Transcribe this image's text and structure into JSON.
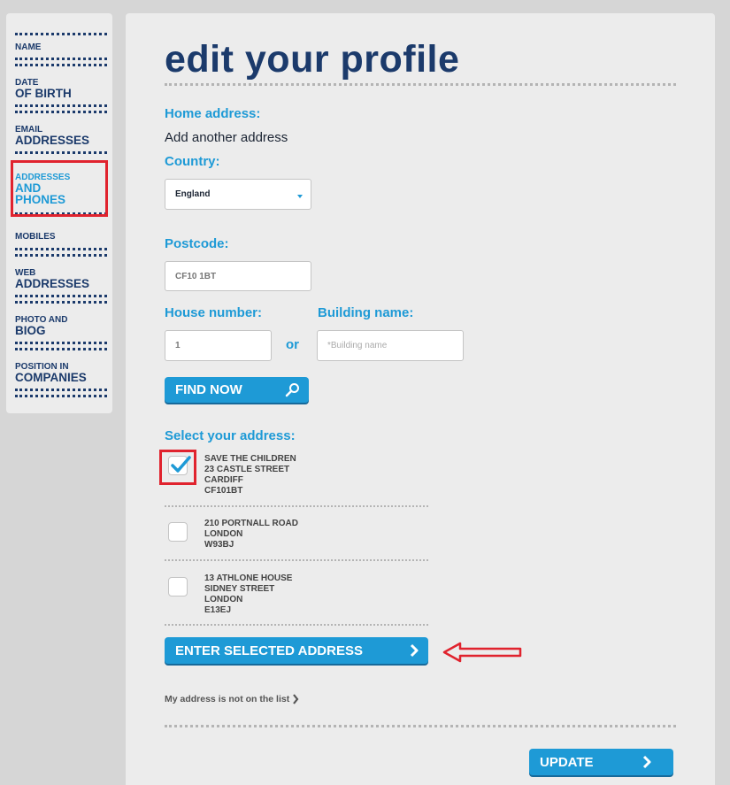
{
  "sidebar": {
    "items": [
      {
        "line1": "",
        "line2": "",
        "label": "NAME"
      },
      {
        "line1": "DATE",
        "line2": "OF BIRTH"
      },
      {
        "line1": "EMAIL",
        "line2": "ADDRESSES"
      },
      {
        "line1": "ADDRESSES",
        "line2": "AND",
        "line3": "PHONES"
      },
      {
        "line1": "MOBILES"
      },
      {
        "line1": "WEB",
        "line2": "ADDRESSES"
      },
      {
        "line1": "PHOTO AND",
        "line2": "BIOG"
      },
      {
        "line1": "POSITION IN",
        "line2": "COMPANIES"
      }
    ]
  },
  "main": {
    "title": "edit your profile",
    "home_address_label": "Home address:",
    "add_another": "Add another address",
    "country_label": "Country:",
    "country_value": "England",
    "postcode_label": "Postcode:",
    "postcode_value": "CF10 1BT",
    "house_number_label": "House number:",
    "house_number_value": "1",
    "or_text": "or",
    "building_name_label": "Building name:",
    "building_name_placeholder": "*Building name",
    "find_now_label": "FIND NOW",
    "select_address_label": "Select your address:",
    "addresses": [
      {
        "lines": [
          "SAVE THE CHILDREN",
          "23 CASTLE STREET",
          "CARDIFF",
          "CF101BT"
        ],
        "checked": true
      },
      {
        "lines": [
          "210 PORTNALL ROAD",
          "LONDON",
          "W93BJ"
        ],
        "checked": false
      },
      {
        "lines": [
          "13 ATHLONE HOUSE",
          "SIDNEY STREET",
          "LONDON",
          "E13EJ"
        ],
        "checked": false
      }
    ],
    "enter_selected_label": "ENTER SELECTED ADDRESS",
    "not_on_list_label": "My address is not on the list",
    "update_label": "UPDATE"
  },
  "colors": {
    "brand_navy": "#1b3a6b",
    "accent_blue": "#1e9ad6",
    "annotation_red": "#e0232e"
  },
  "icons": [
    "search-icon",
    "chevron-right-icon",
    "checkmark-icon",
    "annotation-arrow-icon",
    "dropdown-arrow-icon"
  ]
}
